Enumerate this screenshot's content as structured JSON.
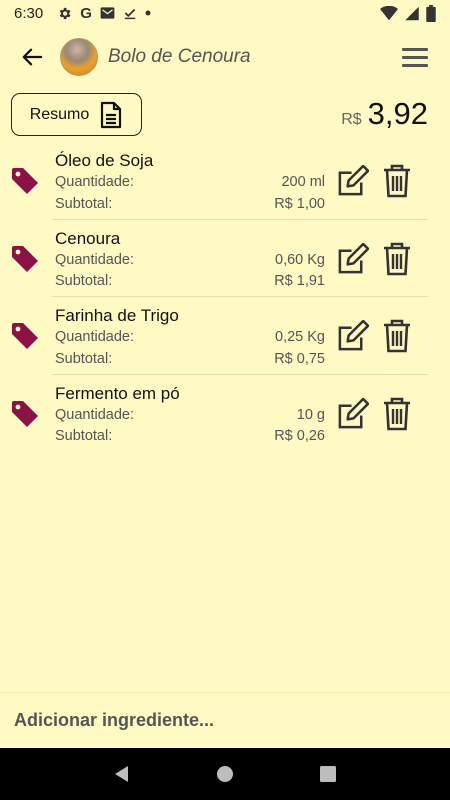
{
  "status_bar": {
    "time": "6:30",
    "left_icons": [
      "gear-icon",
      "google-icon",
      "mail-icon",
      "check-download-icon",
      "dot-icon"
    ],
    "right_icons": [
      "wifi-icon",
      "signal-icon",
      "battery-icon"
    ]
  },
  "app_bar": {
    "title": "Bolo de Cenoura",
    "back_icon": "arrow-left-icon",
    "menu_icon": "hamburger-menu-icon"
  },
  "summary": {
    "button_label": "Resumo",
    "button_icon": "document-icon",
    "total_currency": "R$",
    "total_value": "3,92"
  },
  "labels": {
    "quantity": "Quantidade:",
    "subtotal": "Subtotal:"
  },
  "ingredients": [
    {
      "name": "Óleo de Soja",
      "quantity": "200 ml",
      "subtotal": "R$ 1,00"
    },
    {
      "name": "Cenoura",
      "quantity": "0,60 Kg",
      "subtotal": "R$ 1,91"
    },
    {
      "name": "Farinha de Trigo",
      "quantity": "0,25 Kg",
      "subtotal": "R$ 0,75"
    },
    {
      "name": "Fermento em pó",
      "quantity": "10 g",
      "subtotal": "R$ 0,26"
    }
  ],
  "add_ingredient": {
    "placeholder": "Adicionar ingrediente..."
  },
  "colors": {
    "background": "#fff9c4",
    "tag": "#8a1246",
    "nav_bar": "#000000"
  }
}
